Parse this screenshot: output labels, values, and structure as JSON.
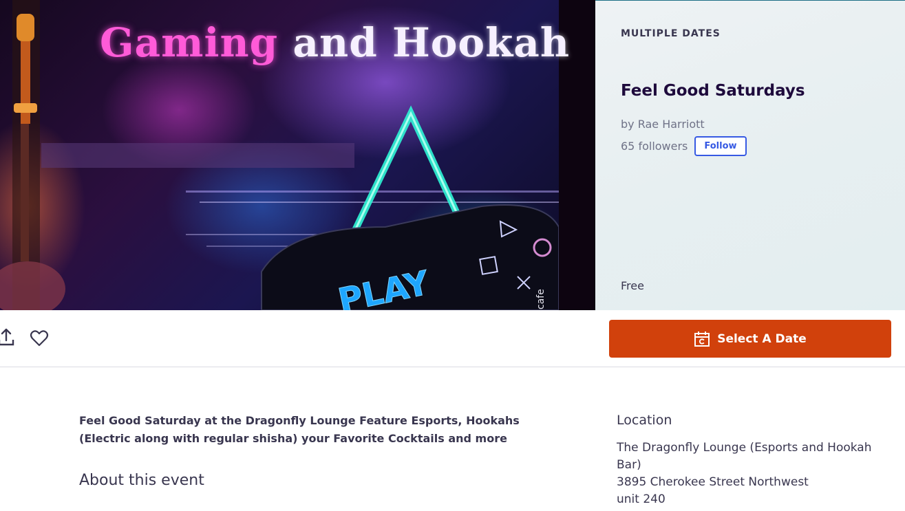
{
  "hero": {
    "image_title_part1": "Gaming",
    "image_title_part2": "and Hookah",
    "image_play_text": "PLAY",
    "image_cafe_text": "cafe"
  },
  "event": {
    "date_label": "MULTIPLE DATES",
    "title": "Feel Good Saturdays",
    "organizer": "by Rae Harriott",
    "followers": "65 followers",
    "follow_label": "Follow",
    "price": "Free"
  },
  "actions": {
    "share_icon": "share-icon",
    "like_icon": "heart-icon",
    "select_date_icon": "calendar-icon",
    "select_date_label": "Select A Date",
    "accent_color": "#d1410c",
    "follow_color": "#3659e3"
  },
  "details": {
    "summary": "Feel Good Saturday at the Dragonfly Lounge Feature Esports, Hookahs (Electric along with regular shisha) your Favorite Cocktails and more",
    "about_heading": "About this event"
  },
  "location": {
    "heading": "Location",
    "lines": [
      "The Dragonfly Lounge (Esports and Hookah Bar)",
      "3895 Cherokee Street Northwest",
      "unit 240"
    ]
  }
}
